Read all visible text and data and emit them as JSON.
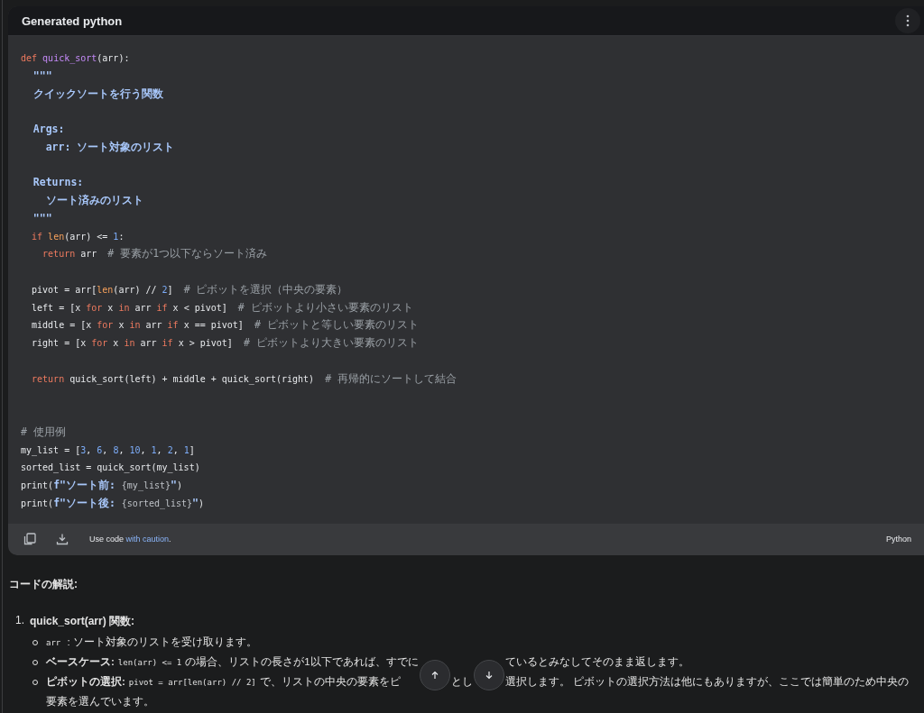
{
  "code_block": {
    "title": "Generated python",
    "lines": [
      {
        "kind": "code",
        "tokens": [
          {
            "kind": "keyword",
            "text": "def "
          },
          {
            "kind": "function",
            "text": "quick_sort"
          },
          {
            "kind": "plain",
            "text": "(arr):"
          }
        ]
      },
      {
        "kind": "code",
        "tokens": [
          {
            "kind": "docstring",
            "text": "  \"\"\""
          }
        ]
      },
      {
        "kind": "code",
        "tokens": [
          {
            "kind": "docstring",
            "text": "  クイックソートを行う関数"
          }
        ]
      },
      {
        "kind": "blank"
      },
      {
        "kind": "code",
        "tokens": [
          {
            "kind": "docstring",
            "text": "  Args:"
          }
        ]
      },
      {
        "kind": "code",
        "tokens": [
          {
            "kind": "docstring",
            "text": "    arr: ソート対象のリスト"
          }
        ]
      },
      {
        "kind": "blank"
      },
      {
        "kind": "code",
        "tokens": [
          {
            "kind": "docstring",
            "text": "  Returns:"
          }
        ]
      },
      {
        "kind": "code",
        "tokens": [
          {
            "kind": "docstring",
            "text": "    ソート済みのリスト"
          }
        ]
      },
      {
        "kind": "code",
        "tokens": [
          {
            "kind": "docstring",
            "text": "  \"\"\""
          }
        ]
      },
      {
        "kind": "code",
        "tokens": [
          {
            "kind": "keyword",
            "text": "  if "
          },
          {
            "kind": "builtin",
            "text": "len"
          },
          {
            "kind": "plain",
            "text": "(arr) <= "
          },
          {
            "kind": "number",
            "text": "1"
          },
          {
            "kind": "plain",
            "text": ":"
          }
        ]
      },
      {
        "kind": "code",
        "tokens": [
          {
            "kind": "keyword",
            "text": "    return "
          },
          {
            "kind": "plain",
            "text": "arr  "
          },
          {
            "kind": "comment",
            "text": "# 要素が1つ以下ならソート済み"
          }
        ]
      },
      {
        "kind": "blank"
      },
      {
        "kind": "code",
        "tokens": [
          {
            "kind": "plain",
            "text": "  pivot = arr["
          },
          {
            "kind": "builtin",
            "text": "len"
          },
          {
            "kind": "plain",
            "text": "(arr) // "
          },
          {
            "kind": "number",
            "text": "2"
          },
          {
            "kind": "plain",
            "text": "]  "
          },
          {
            "kind": "comment",
            "text": "# ピボットを選択（中央の要素）"
          }
        ]
      },
      {
        "kind": "code",
        "tokens": [
          {
            "kind": "plain",
            "text": "  left = [x "
          },
          {
            "kind": "keyword",
            "text": "for"
          },
          {
            "kind": "plain",
            "text": " x "
          },
          {
            "kind": "keyword",
            "text": "in"
          },
          {
            "kind": "plain",
            "text": " arr "
          },
          {
            "kind": "keyword",
            "text": "if"
          },
          {
            "kind": "plain",
            "text": " x < pivot]  "
          },
          {
            "kind": "comment",
            "text": "# ピボットより小さい要素のリスト"
          }
        ]
      },
      {
        "kind": "code",
        "tokens": [
          {
            "kind": "plain",
            "text": "  middle = [x "
          },
          {
            "kind": "keyword",
            "text": "for"
          },
          {
            "kind": "plain",
            "text": " x "
          },
          {
            "kind": "keyword",
            "text": "in"
          },
          {
            "kind": "plain",
            "text": " arr "
          },
          {
            "kind": "keyword",
            "text": "if"
          },
          {
            "kind": "plain",
            "text": " x == pivot]  "
          },
          {
            "kind": "comment",
            "text": "# ピボットと等しい要素のリスト"
          }
        ]
      },
      {
        "kind": "code",
        "tokens": [
          {
            "kind": "plain",
            "text": "  right = [x "
          },
          {
            "kind": "keyword",
            "text": "for"
          },
          {
            "kind": "plain",
            "text": " x "
          },
          {
            "kind": "keyword",
            "text": "in"
          },
          {
            "kind": "plain",
            "text": " arr "
          },
          {
            "kind": "keyword",
            "text": "if"
          },
          {
            "kind": "plain",
            "text": " x > pivot]  "
          },
          {
            "kind": "comment",
            "text": "# ピボットより大きい要素のリスト"
          }
        ]
      },
      {
        "kind": "blank"
      },
      {
        "kind": "code",
        "tokens": [
          {
            "kind": "keyword",
            "text": "  return "
          },
          {
            "kind": "plain",
            "text": "quick_sort(left) + middle + quick_sort(right)  "
          },
          {
            "kind": "comment",
            "text": "# 再帰的にソートして結合"
          }
        ]
      },
      {
        "kind": "blank"
      },
      {
        "kind": "blank"
      },
      {
        "kind": "code",
        "tokens": [
          {
            "kind": "comment",
            "text": "# 使用例"
          }
        ]
      },
      {
        "kind": "code",
        "tokens": [
          {
            "kind": "plain",
            "text": "my_list = ["
          },
          {
            "kind": "number",
            "text": "3"
          },
          {
            "kind": "plain",
            "text": ", "
          },
          {
            "kind": "number",
            "text": "6"
          },
          {
            "kind": "plain",
            "text": ", "
          },
          {
            "kind": "number",
            "text": "8"
          },
          {
            "kind": "plain",
            "text": ", "
          },
          {
            "kind": "number",
            "text": "10"
          },
          {
            "kind": "plain",
            "text": ", "
          },
          {
            "kind": "number",
            "text": "1"
          },
          {
            "kind": "plain",
            "text": ", "
          },
          {
            "kind": "number",
            "text": "2"
          },
          {
            "kind": "plain",
            "text": ", "
          },
          {
            "kind": "number",
            "text": "1"
          },
          {
            "kind": "plain",
            "text": "]"
          }
        ]
      },
      {
        "kind": "code",
        "tokens": [
          {
            "kind": "plain",
            "text": "sorted_list = quick_sort(my_list)"
          }
        ]
      },
      {
        "kind": "code",
        "tokens": [
          {
            "kind": "plain",
            "text": "print("
          },
          {
            "kind": "docstring",
            "text": "f\"ソート前: "
          },
          {
            "kind": "interp",
            "text": "{my_list}"
          },
          {
            "kind": "docstring",
            "text": "\""
          },
          {
            "kind": "plain",
            "text": ")"
          }
        ]
      },
      {
        "kind": "code",
        "tokens": [
          {
            "kind": "plain",
            "text": "print("
          },
          {
            "kind": "docstring",
            "text": "f\"ソート後: "
          },
          {
            "kind": "interp",
            "text": "{sorted_list}"
          },
          {
            "kind": "docstring",
            "text": "\""
          },
          {
            "kind": "plain",
            "text": ")"
          }
        ]
      }
    ],
    "footer": {
      "caution_prefix": "Use code ",
      "caution_link": "with caution",
      "caution_suffix": ".",
      "language": "Python"
    }
  },
  "explanation": {
    "heading": "コードの解説:",
    "items": [
      {
        "number": "1.",
        "title": "quick_sort(arr)  関数:",
        "bullets": [
          {
            "segments": [
              {
                "kind": "code",
                "text": "arr"
              },
              {
                "kind": "text",
                "text": " : ソート対象のリストを受け取ります。"
              }
            ]
          },
          {
            "segments": [
              {
                "kind": "bold",
                "text": "ベースケース:"
              },
              {
                "kind": "code",
                "text": "len(arr) <= 1"
              },
              {
                "kind": "text",
                "text": "の場合、リストの長さが1以下であれば、すでに"
              },
              {
                "kind": "gap"
              },
              {
                "kind": "text",
                "text": "ているとみなしてそのまま返します。"
              }
            ]
          },
          {
            "segments": [
              {
                "kind": "bold",
                "text": "ピボットの選択:"
              },
              {
                "kind": "code",
                "text": "pivot = arr[len(arr) // 2]"
              },
              {
                "kind": "text",
                "text": "で、リストの中央の要素をピ"
              },
              {
                "kind": "gap"
              },
              {
                "kind": "text",
                "text": "とし"
              },
              {
                "kind": "gap"
              },
              {
                "kind": "text",
                "text": "選択します。 ピボットの選択方法は他にもありますが、ここでは簡単のため中央の"
              },
              {
                "kind": "break"
              },
              {
                "kind": "text",
                "text": "要素を選んでいます。"
              }
            ]
          }
        ]
      }
    ]
  }
}
